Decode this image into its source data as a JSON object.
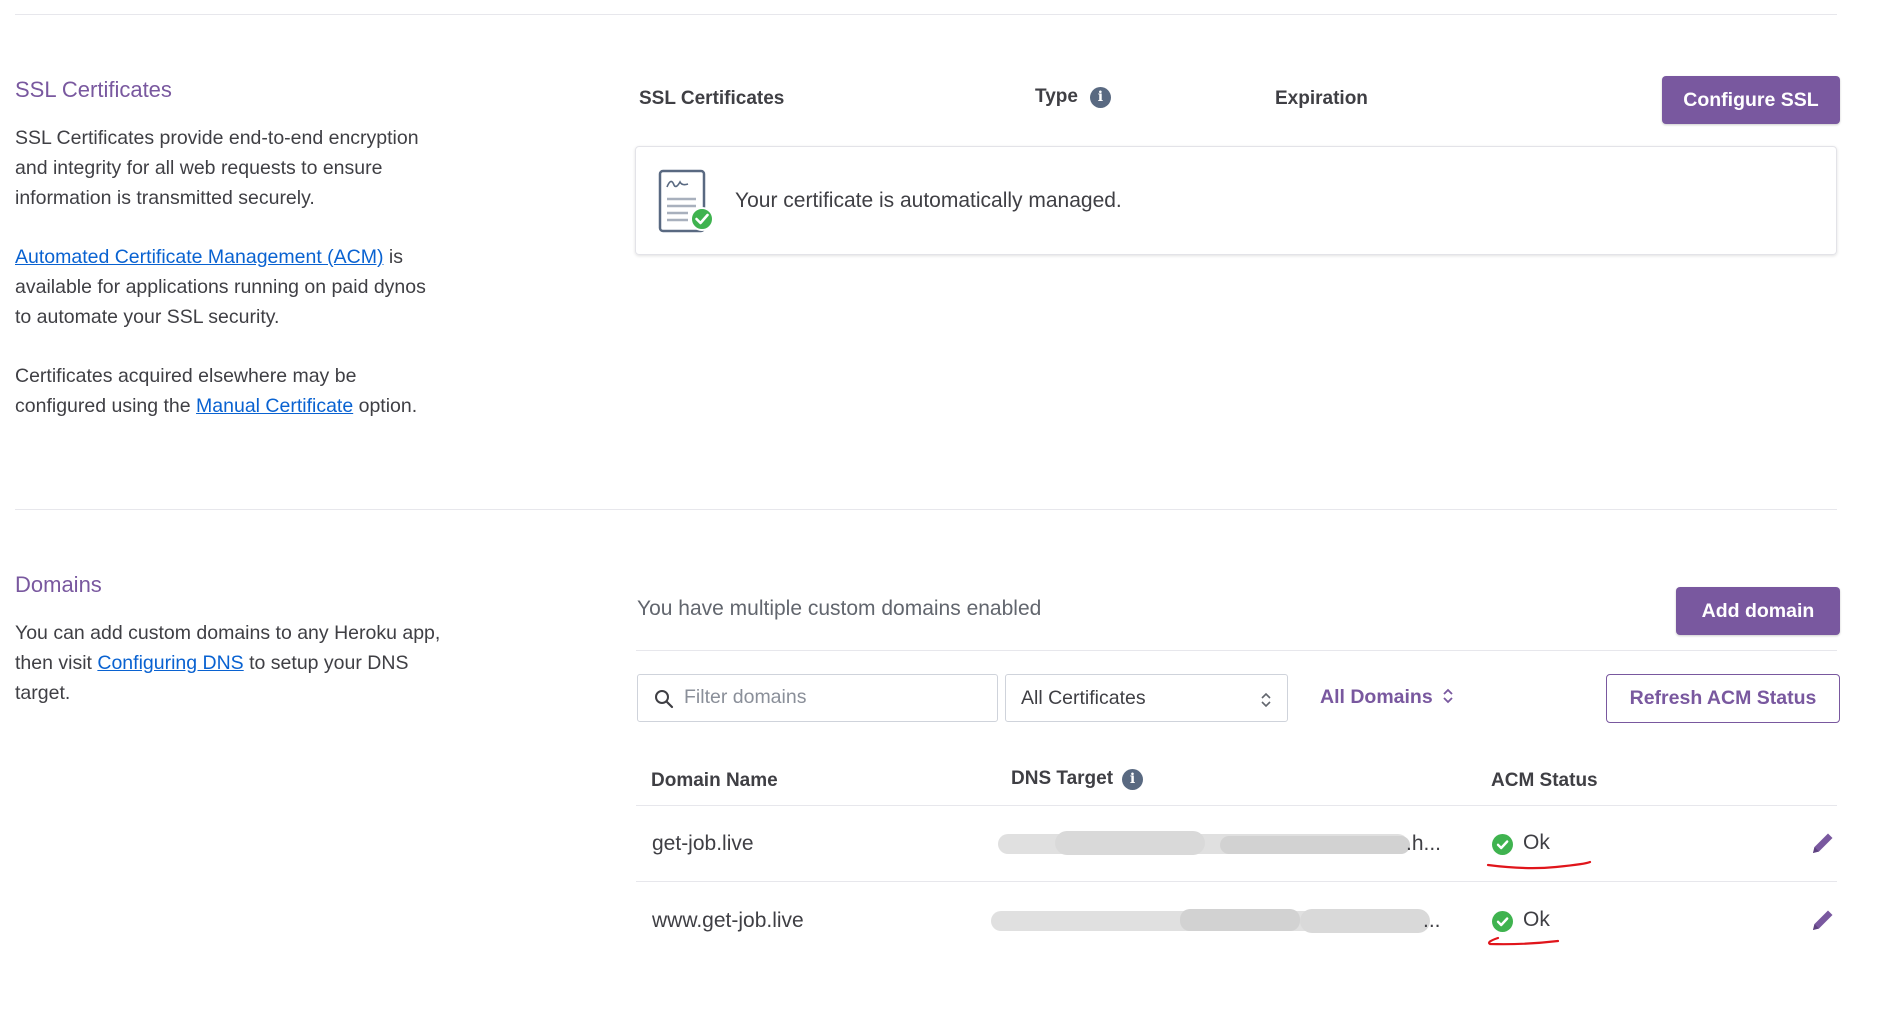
{
  "ssl": {
    "title": "SSL Certificates",
    "desc1": "SSL Certificates provide end-to-end encryption and integrity for all web requests to ensure information is transmitted securely.",
    "acm_link": "Automated Certificate Management (ACM)",
    "desc2_rest": " is available for applications running on paid dynos to automate your SSL security.",
    "desc3_pre": "Certificates acquired elsewhere may be configured using the ",
    "manual_link": "Manual Certificate",
    "desc3_post": " option.",
    "col_cert": "SSL Certificates",
    "col_type": "Type",
    "col_exp": "Expiration",
    "configure_btn": "Configure SSL",
    "managed_text": "Your certificate is automatically managed."
  },
  "domains": {
    "title": "Domains",
    "desc_pre": "You can add custom domains to any Heroku app, then visit ",
    "dns_link": "Configuring DNS",
    "desc_post": " to setup your DNS target.",
    "multiple_text": "You have multiple custom domains enabled",
    "add_btn": "Add domain",
    "filter_placeholder": "Filter domains",
    "cert_select": "All Certificates",
    "domains_toggle": "All Domains",
    "refresh_btn": "Refresh ACM Status",
    "col_name": "Domain Name",
    "col_dns": "DNS Target",
    "col_acm": "ACM Status",
    "rows": [
      {
        "name": "get-job.live",
        "dns_tail": ".h...",
        "status": "Ok"
      },
      {
        "name": "www.get-job.live",
        "dns_tail": "...",
        "status": "Ok"
      }
    ]
  },
  "colors": {
    "accent": "#79589f",
    "link": "#0962d1",
    "ok": "#3fb34f",
    "annotation": "#e0151b"
  },
  "icons": [
    "info-icon",
    "certificate-icon",
    "search-icon",
    "updown-chevron-icon",
    "check-circle-icon",
    "pencil-icon"
  ]
}
